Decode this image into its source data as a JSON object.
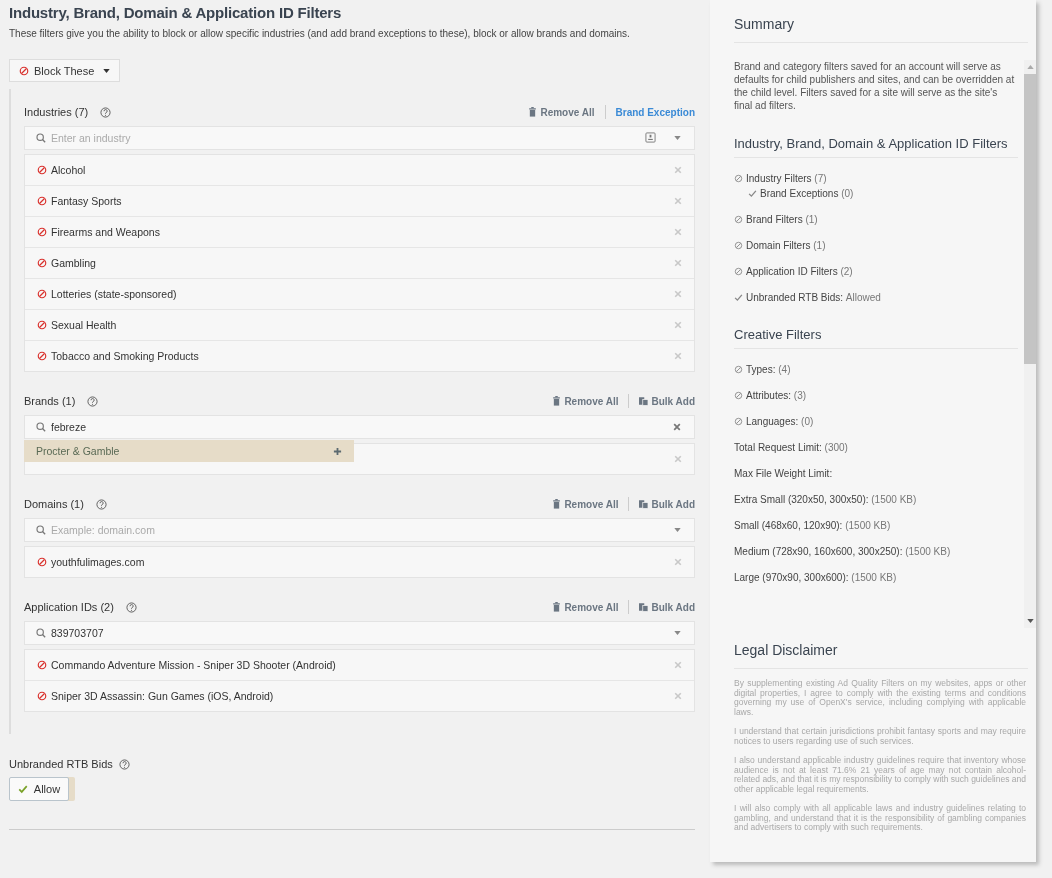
{
  "header": {
    "title": "Industry, Brand, Domain & Application ID Filters",
    "description": "These filters give you the ability to block or allow specific industries (and add brand exceptions to these), block or allow brands and domains."
  },
  "mode_button": {
    "label": "Block These",
    "kind": "block"
  },
  "sections": [
    {
      "label": "Industries (7)",
      "actions": [
        {
          "kind": "remove",
          "label": "Remove All"
        },
        {
          "kind": "link",
          "label": "Brand Exception"
        }
      ],
      "field": {
        "kind": "picker",
        "placeholder": "Enter an industry"
      },
      "items": [
        {
          "text": "Alcohol"
        },
        {
          "text": "Fantasy Sports"
        },
        {
          "text": "Firearms and Weapons"
        },
        {
          "text": "Gambling"
        },
        {
          "text": "Lotteries (state-sponsored)"
        },
        {
          "text": "Sexual Health"
        },
        {
          "text": "Tobacco and Smoking Products"
        }
      ]
    },
    {
      "label": "Brands (1)",
      "actions": [
        {
          "kind": "remove",
          "label": "Remove All"
        },
        {
          "kind": "bulk",
          "label": "Bulk Add"
        }
      ],
      "field": {
        "kind": "clearable",
        "value": "febreze"
      },
      "suggestion": "Procter & Gamble"
    },
    {
      "label": "Domains (1)",
      "actions": [
        {
          "kind": "remove",
          "label": "Remove All"
        },
        {
          "kind": "bulk",
          "label": "Bulk Add"
        }
      ],
      "field": {
        "kind": "dropdown",
        "placeholder": "Example: domain.com"
      },
      "items": [
        {
          "text": "youthfulimages.com"
        }
      ]
    },
    {
      "label": "Application IDs (2)",
      "actions": [
        {
          "kind": "remove",
          "label": "Remove All"
        },
        {
          "kind": "bulk",
          "label": "Bulk Add"
        }
      ],
      "field": {
        "kind": "dropdown",
        "value": "839703707"
      },
      "items": [
        {
          "text": "Commando Adventure Mission - Sniper 3D Shooter (Android)"
        },
        {
          "text": "Sniper 3D Assassin: Gun Games (iOS, Android)"
        }
      ]
    }
  ],
  "unbranded": {
    "label": "Unbranded RTB Bids",
    "button": {
      "label": "Allow",
      "selected": true
    }
  },
  "summary": {
    "title": "Summary",
    "intro": "Brand and category filters saved for an account will serve as defaults for child publishers and sites, and can be overridden at the child level. Filters saved for a site will serve as the site's final ad filters.",
    "groups": [
      {
        "title": "Industry, Brand, Domain & Application ID Filters",
        "items": [
          {
            "kind": "blocked",
            "label": "Industry Filters",
            "count": "(7)",
            "children": [
              {
                "kind": "allowed",
                "label": "Brand Exceptions",
                "count": "(0)"
              }
            ]
          },
          {
            "kind": "blocked",
            "label": "Brand Filters",
            "count": "(1)"
          },
          {
            "kind": "blocked",
            "label": "Domain Filters",
            "count": "(1)"
          },
          {
            "kind": "blocked",
            "label": "Application ID Filters",
            "count": "(2)"
          },
          {
            "kind": "allowed",
            "label": "Unbranded RTB Bids:",
            "count": "Allowed"
          }
        ]
      },
      {
        "title": "Creative Filters",
        "items": [
          {
            "kind": "blocked",
            "label": "Types:",
            "count": "(4)"
          },
          {
            "kind": "blocked",
            "label": "Attributes:",
            "count": "(3)"
          },
          {
            "kind": "blocked",
            "label": "Languages:",
            "count": "(0)"
          },
          {
            "kind": "plain",
            "label": "Total Request Limit:",
            "count": "(300)"
          },
          {
            "kind": "plain",
            "label": "Max File Weight Limit:"
          },
          {
            "kind": "plain",
            "label": "Extra Small (320x50, 300x50):",
            "count": "(1500 KB)"
          },
          {
            "kind": "plain",
            "label": "Small (468x60, 120x90):",
            "count": "(1500 KB)"
          },
          {
            "kind": "plain",
            "label": "Medium (728x90, 160x600, 300x250):",
            "count": "(1500 KB)"
          },
          {
            "kind": "plain",
            "label": "Large (970x90, 300x600):",
            "count": "(1500 KB)"
          }
        ]
      }
    ]
  },
  "legal": {
    "title": "Legal Disclaimer",
    "paragraphs": [
      "By supplementing existing Ad Quality Filters on my websites, apps or other digital properties, I agree to comply with the existing terms and conditions governing my use of OpenX's service, including complying with applicable laws.",
      "I understand that certain jurisdictions prohibit fantasy sports and may require notices to users regarding use of such services.",
      "I also understand applicable industry guidelines require that inventory whose audience is not at least 71.6% 21 years of age may not contain alcohol-related ads, and that it is my responsibility to comply with such guidelines and other applicable legal requirements.",
      "I will also comply with all applicable laws and industry guidelines relating to gambling, and understand that it is the responsibility of gambling companies and advertisers to comply with such requirements."
    ]
  }
}
